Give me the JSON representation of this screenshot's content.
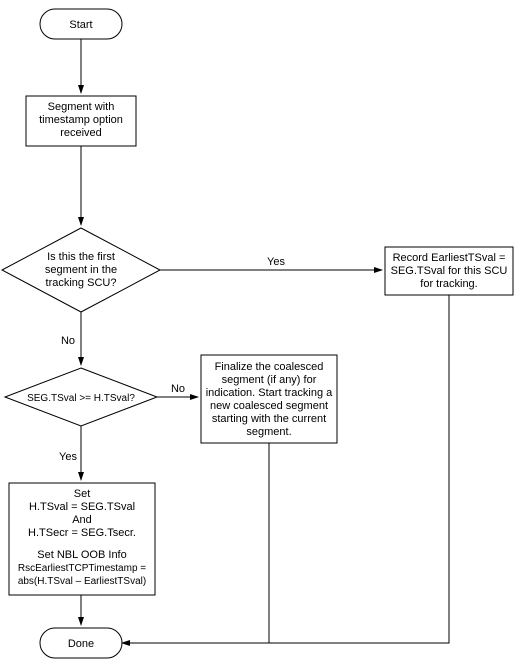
{
  "flow": {
    "start": "Start",
    "step1_line1": "Segment with",
    "step1_line2": "timestamp option",
    "step1_line3": "received",
    "dec1_line1": "Is this the first",
    "dec1_line2": "segment in the",
    "dec1_line3": "tracking SCU?",
    "dec1_yes": "Yes",
    "dec1_no": "No",
    "record_line1": "Record EarliestTSval  =",
    "record_line2": "SEG.TSval for this SCU",
    "record_line3": "for tracking.",
    "dec2": "SEG.TSval  >= H.TSval?",
    "dec2_yes": "Yes",
    "dec2_no": "No",
    "finalize_line1": "Finalize the coalesced",
    "finalize_line2": "segment (if any) for",
    "finalize_line3": "indication. Start tracking a",
    "finalize_line4": "new coalesced segment",
    "finalize_line5": "starting with the current",
    "finalize_line6": "segment.",
    "set_line1": "Set",
    "set_line2": "H.TSval = SEG.TSval",
    "set_line3": "And",
    "set_line4": "H.TSecr = SEG.Tsecr.",
    "set_line5": "Set NBL OOB Info",
    "set_line6": "RscEarliestTCPTimestamp =",
    "set_line7": "abs(H.TSval – EarliestTSval)",
    "done": "Done"
  }
}
